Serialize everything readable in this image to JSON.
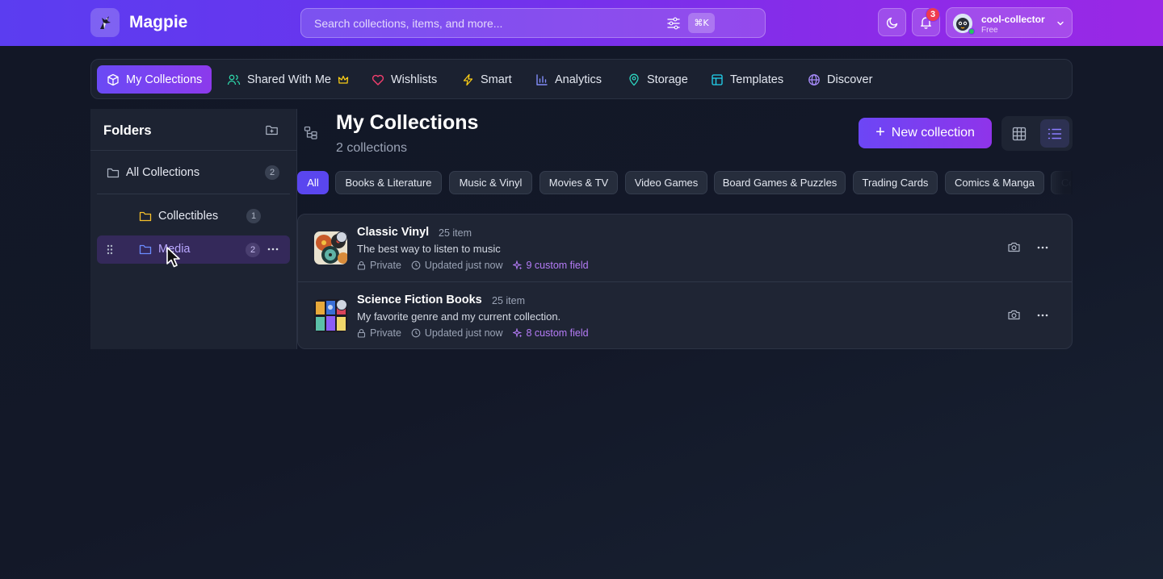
{
  "header": {
    "brand": "Magpie",
    "search_placeholder": "Search collections, items, and more...",
    "shortcut": "⌘K",
    "notification_count": "3",
    "user": {
      "name": "cool-collector",
      "plan": "Free"
    }
  },
  "nav": {
    "tabs": [
      {
        "label": "My Collections",
        "icon": "cube-icon",
        "active": true
      },
      {
        "label": "Shared With Me",
        "icon": "users-icon"
      },
      {
        "label": "Wishlists",
        "icon": "heart-icon"
      },
      {
        "label": "Smart",
        "icon": "bolt-icon"
      },
      {
        "label": "Analytics",
        "icon": "bar-chart-icon"
      },
      {
        "label": "Storage",
        "icon": "map-pin-icon"
      },
      {
        "label": "Templates",
        "icon": "layout-icon"
      },
      {
        "label": "Discover",
        "icon": "globe-icon"
      }
    ]
  },
  "sidebar": {
    "title": "Folders",
    "all": {
      "label": "All Collections",
      "count": "2"
    },
    "folders": [
      {
        "label": "Collectibles",
        "count": "1"
      },
      {
        "label": "Media",
        "count": "2",
        "selected": true
      }
    ]
  },
  "main": {
    "title": "My Collections",
    "subtitle": "2 collections",
    "new_button": "New collection",
    "chips": [
      "All",
      "Books & Literature",
      "Music & Vinyl",
      "Movies & TV",
      "Video Games",
      "Board Games & Puzzles",
      "Trading Cards",
      "Comics & Manga",
      "Co"
    ],
    "collections": [
      {
        "name": "Classic Vinyl",
        "count": "25 item",
        "description": "The best way to listen to music",
        "privacy": "Private",
        "updated": "Updated just now",
        "custom": "9 custom field"
      },
      {
        "name": "Science Fiction Books",
        "count": "25 item",
        "description": "My favorite genre and my current collection.",
        "privacy": "Private",
        "updated": "Updated just now",
        "custom": "8 custom field"
      }
    ]
  },
  "colors": {
    "accent": "#6a4af5",
    "accent2": "#8c3aec",
    "custom_field": "#b57cf7",
    "folder_yellow": "#f5c02b",
    "folder_blue": "#6b8cff"
  }
}
